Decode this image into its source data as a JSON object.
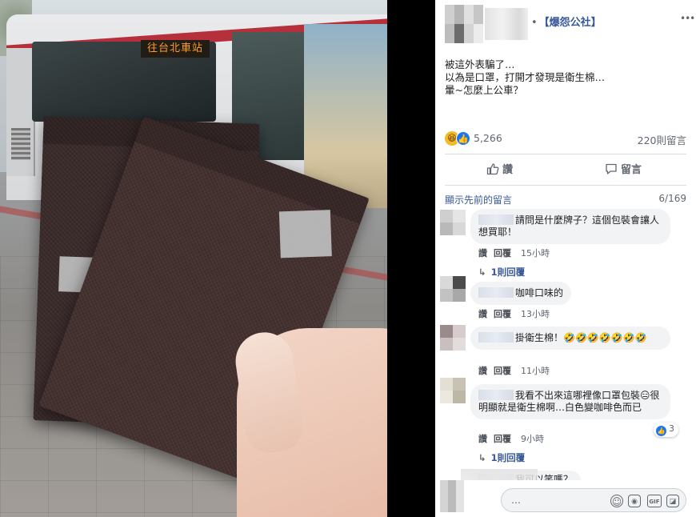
{
  "photo": {
    "bus_sign": "往台北車站"
  },
  "post": {
    "group_name": "【爆怨公社】",
    "text_lines": [
      "被這外表騙了…",
      "以為是口罩，打開才發現是衛生棉…",
      "暈~怎麼上公車？"
    ],
    "reaction_count": "5,266",
    "comment_count": "220則留言"
  },
  "actions": {
    "like": "讚",
    "comment": "留言"
  },
  "comments_header": {
    "previous": "顯示先前的留言",
    "page": "6/169"
  },
  "comments": [
    {
      "text": "請問是什麼牌子？這個包裝會讓人想買耶！",
      "like": "讚",
      "reply": "回覆",
      "time": "15小時",
      "replies": "1則回覆"
    },
    {
      "text": "咖啡口味的",
      "like": "讚",
      "reply": "回覆",
      "time": "13小時"
    },
    {
      "text": "掛衛生棉！🤣🤣🤣🤣🤣🤣🤣",
      "like": "讚",
      "reply": "回覆",
      "time": "11小時"
    },
    {
      "text": "我看不出來這哪裡像口罩包裝😑很明顯就是衛生棉啊…白色變咖啡色而已",
      "like": "讚",
      "reply": "回覆",
      "time": "9小時",
      "reactions": "3",
      "replies": "1則回覆"
    },
    {
      "text": "我可以笑嗎？"
    }
  ],
  "input": {
    "placeholder": "…"
  },
  "icons": {
    "more": "more-icon",
    "haha": "haha-reaction-icon",
    "like": "like-reaction-icon",
    "thumb": "thumbs-up-icon",
    "bubble": "comment-bubble-icon",
    "emoji": "emoji-icon",
    "camera": "camera-icon",
    "gif": "gif-icon",
    "sticker": "sticker-icon"
  },
  "colors": {
    "link": "#385898",
    "meta": "#606770",
    "bubble_bg": "#f2f3f5",
    "like_blue": "#1877f2"
  }
}
